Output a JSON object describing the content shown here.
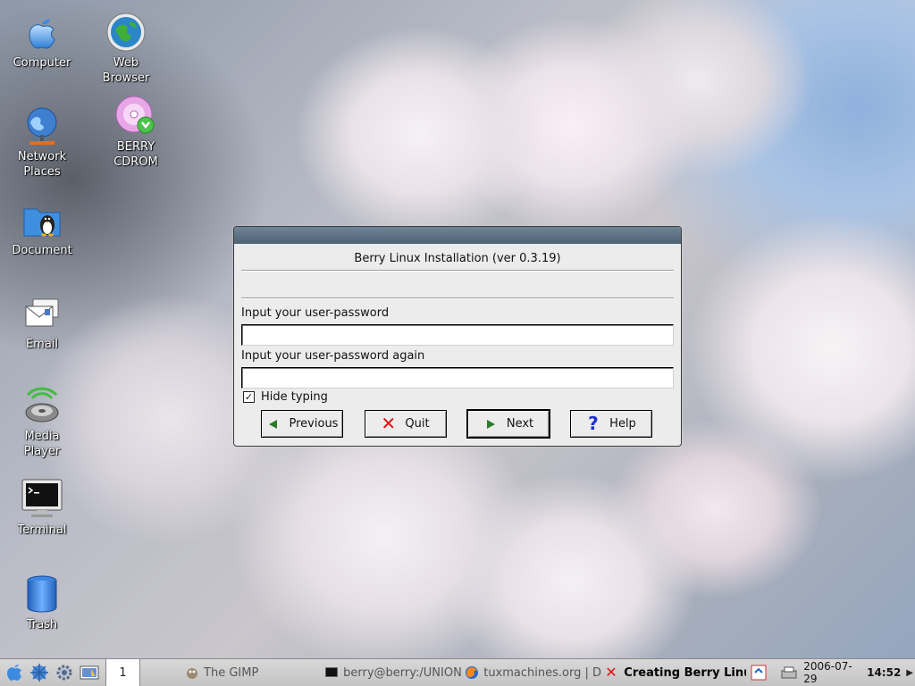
{
  "desktop": {
    "icons": [
      {
        "id": "computer",
        "label": "Computer"
      },
      {
        "id": "web_browser",
        "label": "Web\nBrowser"
      },
      {
        "id": "berry_cdrom",
        "label": "BERRY\nCDROM"
      },
      {
        "id": "network_places",
        "label": "Network\nPlaces"
      },
      {
        "id": "document",
        "label": "Document"
      },
      {
        "id": "email",
        "label": "Email"
      },
      {
        "id": "media_player",
        "label": "Media\nPlayer"
      },
      {
        "id": "terminal",
        "label": "Terminal"
      },
      {
        "id": "trash",
        "label": "Trash"
      }
    ]
  },
  "dialog": {
    "title": "Berry Linux Installation (ver 0.3.19)",
    "password_label": "Input your user-password",
    "password_value": "",
    "password_again_label": "Input your user-password again",
    "password_again_value": "",
    "hide_typing_label": "Hide typing",
    "hide_typing_checked": true,
    "buttons": {
      "previous": "Previous",
      "quit": "Quit",
      "next": "Next",
      "help": "Help"
    }
  },
  "taskbar": {
    "pager_current": "1",
    "tasks": [
      {
        "label": "The GIMP",
        "active": false
      },
      {
        "label": "berry@berry:/UNIONFS",
        "active": false
      },
      {
        "label": "tuxmachines.org | D",
        "active": false
      },
      {
        "label": "Creating Berry Linu",
        "active": true
      }
    ],
    "date": "2006-07-29",
    "time": "14:52"
  },
  "colors": {
    "titlebar": "#5a7082",
    "button_arrow": "#2a7a2a",
    "quit_x": "#dd1111",
    "help_q": "#1a2fcf"
  }
}
